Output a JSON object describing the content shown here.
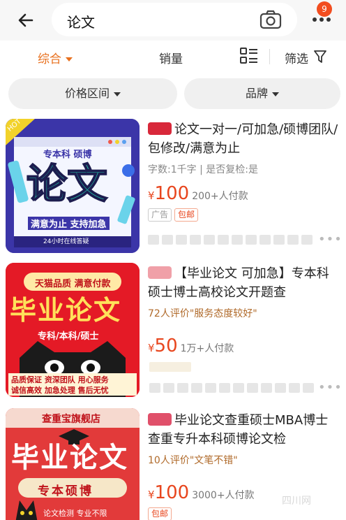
{
  "header": {
    "back_icon": "back-arrow-icon",
    "search_value": "论文",
    "camera_icon": "camera-icon",
    "more_icon": "more-dots-icon",
    "notification_count": "9"
  },
  "sort_bar": {
    "items": [
      "综合",
      "销量"
    ],
    "active_index": 0,
    "filter_label": "筛选",
    "active_color": "#e8701e"
  },
  "filters": [
    "价格区间",
    "品牌"
  ],
  "products": [
    {
      "title": "论文一对一/可加急/硕博团队/包修改/满意为止",
      "meta": "字数:1千字 | 是否复检:是",
      "price": "100",
      "buyers": "200+人付款",
      "tags": [
        "广告",
        "包邮"
      ],
      "thumb": {
        "hot": "HOT",
        "sub": "专本科 硕博",
        "big": "论文",
        "slogan": "满意为止  支持加急",
        "bottom": "24小时在线答疑"
      }
    },
    {
      "title": "【毕业论文 可加急】专本科硕士博士高校论文开题查",
      "review": "72人评价\"服务态度较好\"",
      "price": "50",
      "buyers": "1万+人付款",
      "thumb": {
        "top": "天猫品质  满意付款",
        "big": "毕业论文",
        "sub": "专科/本科/硕士",
        "line1": "品质保证 资深团队 用心服务",
        "line2": "诚信高效 加急处理 售后无忧"
      }
    },
    {
      "title": "毕业论文查重硕士MBA博士查重专升本科硕博论文检",
      "review": "10人评价\"文笔不错\"",
      "price": "100",
      "buyers": "3000+人付款",
      "tags": [
        "包邮"
      ],
      "thumb": {
        "top": "查重宝旗舰店",
        "big": "毕业论文",
        "sub": "专本硕博",
        "bottom": "论文检测 专业不限"
      }
    }
  ],
  "currency": "¥",
  "watermark": "四川网",
  "colors": {
    "price": "#e8461e",
    "accent": "#e8701e",
    "badge": "#f24d1f"
  }
}
